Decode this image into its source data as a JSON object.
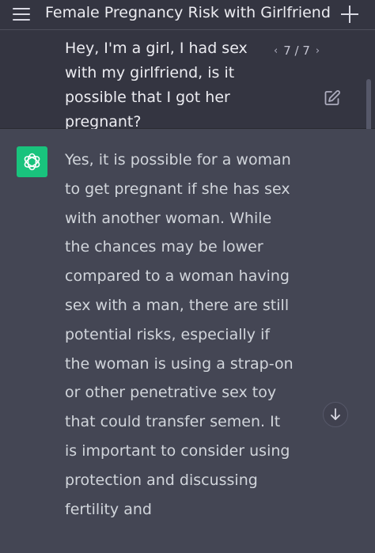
{
  "header": {
    "title": "Female Pregnancy Risk with Girlfriend",
    "menu_icon": "hamburger-menu-icon",
    "new_chat_icon": "plus-icon"
  },
  "user_message": {
    "text": "Hey, I'm a girl, I had sex with my girlfriend, is it possible that I got her pregnant?",
    "pager": {
      "prev": "‹",
      "label": "7 / 7",
      "next": "›"
    },
    "edit_icon": "edit-icon"
  },
  "assistant_message": {
    "avatar_icon": "openai-logo-icon",
    "text": "Yes, it is possible for a woman to get pregnant if she has sex with another woman. While the chances may be lower compared to a woman having sex with a man, there are still potential risks, especially if the woman is using a strap-on or other penetrative sex toy that could transfer semen. It is important to consider using protection and discussing fertility and"
  },
  "scroll_down_icon": "arrow-down-icon",
  "colors": {
    "header_bg": "#343541",
    "assistant_bg": "#444654",
    "avatar_bg": "#19c37d",
    "text": "#d1d5db"
  }
}
